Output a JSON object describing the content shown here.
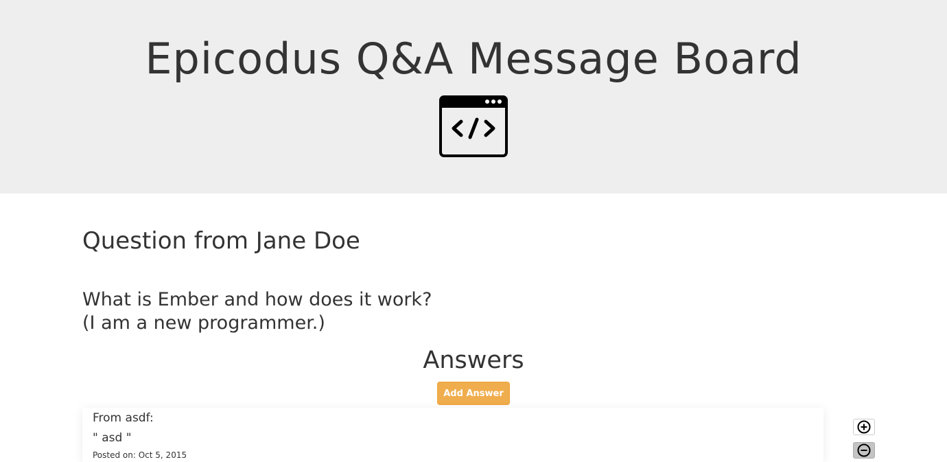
{
  "header": {
    "title": "Epicodus Q&A Message Board",
    "logo_icon": "code-window-icon"
  },
  "question": {
    "title": "Question from Jane Doe",
    "body_line1": "What is Ember and how does it work?",
    "body_line2": "(I am a new programmer.)"
  },
  "answers": {
    "heading": "Answers",
    "add_button_label": "Add Answer",
    "items": [
      {
        "author": "From asdf:",
        "text": "\" asd \"",
        "date": "Posted on: Oct 5, 2015",
        "upvote_icon": "plus-circle-icon",
        "downvote_icon": "minus-circle-icon"
      }
    ]
  },
  "colors": {
    "header_bg": "#eeeeee",
    "accent_button": "#f0ad4e",
    "text": "#333333"
  }
}
